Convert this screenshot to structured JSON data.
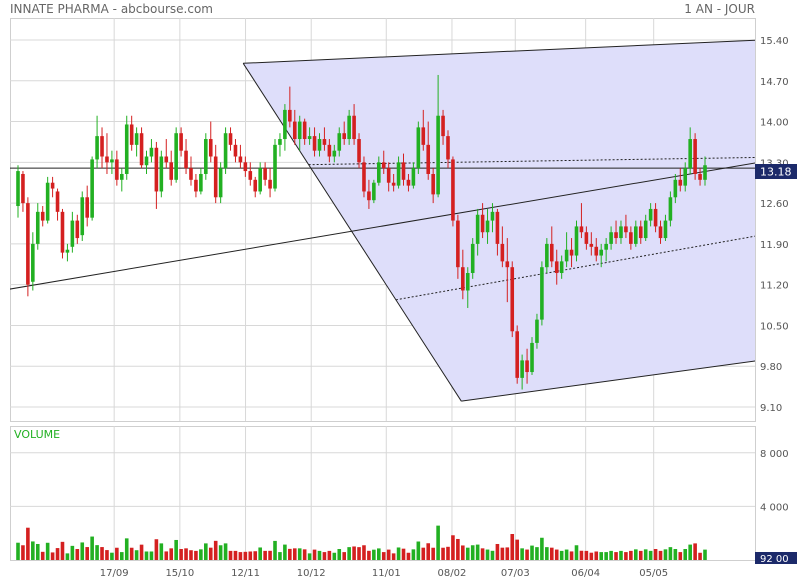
{
  "header": {
    "title": "INNATE PHARMA - abcbourse.com",
    "period": "1 AN - JOUR"
  },
  "colors": {
    "up": "#22b022",
    "down": "#d42020",
    "grid": "#d8d8d8",
    "fan_fill": "#dedefa",
    "axis_text": "#555555",
    "volume_label": "#22b022",
    "price_tag_bg": "#1c2a6a"
  },
  "chart_data": [
    {
      "type": "candlestick",
      "title": "",
      "price_ticks": [
        "15.40",
        "14.70",
        "14.00",
        "13.30",
        "12.60",
        "11.90",
        "11.20",
        "10.50",
        "9.80",
        "9.10"
      ],
      "ylim": [
        9.1,
        15.4
      ],
      "x_ticks": [
        {
          "label": "17/09",
          "day": 48
        },
        {
          "label": "15/10",
          "day": 76
        },
        {
          "label": "12/11",
          "day": 104
        },
        {
          "label": "10/12",
          "day": 132
        },
        {
          "label": "11/01",
          "day": 164
        },
        {
          "label": "08/02",
          "day": 192
        },
        {
          "label": "07/03",
          "day": 219
        },
        {
          "label": "06/04",
          "day": 249
        },
        {
          "label": "05/05",
          "day": 278
        }
      ],
      "grid": true,
      "current_price": {
        "value": 13.18,
        "label": "13.18"
      },
      "horizontal_line": 13.2,
      "candles_ohlc": [
        [
          12.55,
          13.25,
          12.35,
          13.15
        ],
        [
          13.1,
          13.15,
          12.45,
          12.6
        ],
        [
          12.6,
          12.7,
          11.0,
          11.2
        ],
        [
          11.25,
          12.1,
          11.1,
          11.9
        ],
        [
          11.9,
          12.6,
          11.8,
          12.45
        ],
        [
          12.45,
          12.55,
          12.2,
          12.3
        ],
        [
          12.3,
          13.05,
          12.25,
          12.95
        ],
        [
          12.95,
          13.05,
          12.7,
          12.85
        ],
        [
          12.8,
          12.85,
          12.3,
          12.45
        ],
        [
          12.45,
          12.5,
          11.65,
          11.75
        ],
        [
          11.75,
          11.9,
          11.6,
          11.8
        ],
        [
          11.85,
          12.45,
          11.75,
          12.3
        ],
        [
          12.3,
          12.4,
          11.9,
          12.0
        ],
        [
          12.05,
          12.8,
          11.95,
          12.7
        ],
        [
          12.7,
          12.9,
          12.2,
          12.35
        ],
        [
          12.35,
          13.4,
          12.3,
          13.35
        ],
        [
          13.35,
          14.1,
          13.2,
          13.75
        ],
        [
          13.75,
          13.9,
          13.2,
          13.4
        ],
        [
          13.4,
          13.8,
          13.1,
          13.3
        ],
        [
          13.3,
          13.5,
          13.1,
          13.35
        ],
        [
          13.35,
          13.5,
          12.9,
          13.0
        ],
        [
          13.0,
          13.2,
          12.8,
          13.1
        ],
        [
          13.1,
          14.1,
          13.0,
          13.95
        ],
        [
          13.95,
          14.1,
          13.5,
          13.6
        ],
        [
          13.6,
          13.9,
          13.4,
          13.8
        ],
        [
          13.8,
          13.9,
          13.2,
          13.25
        ],
        [
          13.25,
          13.5,
          13.1,
          13.4
        ],
        [
          13.4,
          13.7,
          13.3,
          13.55
        ],
        [
          13.55,
          13.65,
          12.5,
          12.8
        ],
        [
          12.8,
          13.5,
          12.7,
          13.4
        ],
        [
          13.4,
          13.7,
          13.2,
          13.3
        ],
        [
          13.3,
          13.5,
          12.9,
          13.0
        ],
        [
          13.0,
          13.9,
          12.95,
          13.8
        ],
        [
          13.8,
          13.9,
          13.4,
          13.5
        ],
        [
          13.5,
          13.7,
          13.1,
          13.2
        ],
        [
          13.2,
          13.4,
          12.9,
          13.0
        ],
        [
          13.0,
          13.1,
          12.7,
          12.8
        ],
        [
          12.8,
          13.2,
          12.75,
          13.1
        ],
        [
          13.1,
          13.8,
          13.0,
          13.7
        ],
        [
          13.7,
          14.0,
          13.3,
          13.4
        ],
        [
          13.4,
          13.6,
          12.6,
          12.7
        ],
        [
          12.7,
          13.3,
          12.6,
          13.2
        ],
        [
          13.2,
          13.9,
          13.1,
          13.8
        ],
        [
          13.8,
          13.9,
          13.5,
          13.6
        ],
        [
          13.6,
          13.7,
          13.3,
          13.4
        ],
        [
          13.4,
          13.6,
          13.2,
          13.3
        ],
        [
          13.3,
          13.4,
          13.05,
          13.15
        ],
        [
          13.15,
          13.3,
          12.9,
          13.0
        ],
        [
          13.0,
          13.05,
          12.7,
          12.8
        ],
        [
          12.8,
          13.3,
          12.75,
          13.2
        ],
        [
          13.2,
          13.3,
          12.9,
          13.0
        ],
        [
          13.0,
          13.2,
          12.7,
          12.85
        ],
        [
          12.85,
          13.7,
          12.8,
          13.6
        ],
        [
          13.6,
          13.8,
          13.4,
          13.7
        ],
        [
          13.7,
          14.3,
          13.5,
          14.2
        ],
        [
          14.2,
          14.6,
          13.9,
          14.0
        ],
        [
          14.0,
          14.2,
          13.6,
          13.7
        ],
        [
          13.7,
          14.1,
          13.5,
          14.0
        ],
        [
          14.0,
          14.05,
          13.6,
          13.7
        ],
        [
          13.7,
          13.9,
          13.6,
          13.75
        ],
        [
          13.75,
          13.9,
          13.4,
          13.5
        ],
        [
          13.5,
          13.8,
          13.4,
          13.7
        ],
        [
          13.7,
          13.9,
          13.5,
          13.6
        ],
        [
          13.6,
          13.7,
          13.3,
          13.4
        ],
        [
          13.4,
          13.6,
          13.3,
          13.5
        ],
        [
          13.5,
          13.9,
          13.4,
          13.8
        ],
        [
          13.8,
          14.0,
          13.6,
          13.7
        ],
        [
          13.7,
          14.2,
          13.6,
          14.1
        ],
        [
          14.1,
          14.3,
          13.6,
          13.7
        ],
        [
          13.7,
          13.8,
          13.2,
          13.3
        ],
        [
          13.3,
          13.4,
          12.7,
          12.8
        ],
        [
          12.8,
          13.0,
          12.5,
          12.65
        ],
        [
          12.65,
          13.0,
          12.6,
          12.95
        ],
        [
          12.95,
          13.4,
          12.9,
          13.3
        ],
        [
          13.3,
          13.5,
          13.1,
          13.2
        ],
        [
          13.2,
          13.3,
          12.8,
          12.95
        ],
        [
          12.95,
          13.1,
          12.8,
          12.9
        ],
        [
          12.9,
          13.4,
          12.85,
          13.3
        ],
        [
          13.3,
          13.45,
          12.9,
          13.0
        ],
        [
          13.0,
          13.1,
          12.8,
          12.9
        ],
        [
          12.9,
          13.3,
          12.85,
          13.2
        ],
        [
          13.2,
          14.0,
          13.1,
          13.9
        ],
        [
          13.9,
          14.2,
          13.5,
          13.6
        ],
        [
          13.6,
          14.0,
          13.0,
          13.1
        ],
        [
          13.1,
          13.2,
          12.6,
          12.75
        ],
        [
          12.75,
          14.8,
          12.7,
          14.1
        ],
        [
          14.1,
          14.2,
          13.6,
          13.75
        ],
        [
          13.75,
          13.85,
          13.2,
          13.35
        ],
        [
          13.35,
          13.4,
          12.2,
          12.3
        ],
        [
          12.3,
          12.4,
          11.3,
          11.5
        ],
        [
          11.5,
          11.8,
          10.95,
          11.1
        ],
        [
          11.1,
          11.5,
          10.8,
          11.4
        ],
        [
          11.4,
          12.0,
          11.3,
          11.9
        ],
        [
          11.9,
          12.5,
          11.7,
          12.4
        ],
        [
          12.4,
          12.6,
          12.0,
          12.1
        ],
        [
          12.1,
          12.5,
          11.9,
          12.3
        ],
        [
          12.3,
          12.6,
          12.1,
          12.45
        ],
        [
          12.45,
          12.5,
          11.7,
          11.9
        ],
        [
          11.9,
          12.2,
          11.5,
          11.6
        ],
        [
          11.6,
          12.0,
          10.9,
          11.5
        ],
        [
          11.5,
          11.6,
          10.3,
          10.4
        ],
        [
          10.4,
          10.5,
          9.5,
          9.6
        ],
        [
          9.6,
          10.0,
          9.4,
          9.9
        ],
        [
          9.9,
          10.1,
          9.5,
          9.7
        ],
        [
          9.7,
          10.3,
          9.65,
          10.2
        ],
        [
          10.2,
          10.7,
          10.1,
          10.6
        ],
        [
          10.6,
          11.6,
          10.5,
          11.5
        ],
        [
          11.5,
          12.0,
          11.4,
          11.9
        ],
        [
          11.9,
          12.2,
          11.5,
          11.6
        ],
        [
          11.6,
          11.8,
          11.2,
          11.4
        ],
        [
          11.4,
          11.7,
          11.3,
          11.6
        ],
        [
          11.6,
          12.1,
          11.5,
          11.8
        ],
        [
          11.8,
          12.0,
          11.5,
          11.7
        ],
        [
          11.7,
          12.3,
          11.6,
          12.2
        ],
        [
          12.2,
          12.6,
          12.0,
          12.1
        ],
        [
          12.1,
          12.2,
          11.8,
          11.9
        ],
        [
          11.9,
          12.1,
          11.7,
          11.85
        ],
        [
          11.85,
          12.0,
          11.6,
          11.7
        ],
        [
          11.7,
          11.9,
          11.5,
          11.8
        ],
        [
          11.8,
          12.0,
          11.6,
          11.9
        ],
        [
          11.9,
          12.2,
          11.8,
          12.1
        ],
        [
          12.1,
          12.3,
          11.9,
          12.0
        ],
        [
          12.0,
          12.3,
          11.9,
          12.2
        ],
        [
          12.2,
          12.4,
          12.0,
          12.1
        ],
        [
          12.1,
          12.2,
          11.8,
          11.9
        ],
        [
          11.9,
          12.3,
          11.85,
          12.2
        ],
        [
          12.2,
          12.3,
          11.9,
          12.0
        ],
        [
          12.0,
          12.4,
          11.95,
          12.3
        ],
        [
          12.3,
          12.6,
          12.2,
          12.5
        ],
        [
          12.5,
          12.6,
          12.1,
          12.2
        ],
        [
          12.2,
          12.3,
          11.9,
          12.0
        ],
        [
          12.0,
          12.4,
          11.95,
          12.3
        ],
        [
          12.3,
          12.8,
          12.2,
          12.7
        ],
        [
          12.7,
          13.1,
          12.6,
          13.0
        ],
        [
          13.0,
          13.2,
          12.8,
          12.9
        ],
        [
          12.9,
          13.3,
          12.8,
          13.2
        ],
        [
          13.2,
          13.9,
          13.1,
          13.7
        ],
        [
          13.7,
          13.8,
          13.0,
          13.1
        ],
        [
          13.1,
          13.2,
          12.9,
          13.0
        ],
        [
          13.0,
          13.4,
          12.9,
          13.25
        ]
      ],
      "overlays": [
        {
          "kind": "andrews_pitchfork_fan",
          "pivots": [
            {
              "day": 103,
              "price": 15.0
            },
            {
              "day": 196,
              "price": 9.2
            }
          ],
          "median_line": [
            {
              "day": 0,
              "price": 11.1
            },
            {
              "day": 323,
              "price": 13.3
            }
          ],
          "upper_line": [
            {
              "day": 103,
              "price": 15.0
            },
            {
              "day": 323,
              "price": 15.4
            }
          ],
          "lower_line": [
            {
              "day": 196,
              "price": 9.2
            },
            {
              "day": 323,
              "price": 9.9
            }
          ]
        }
      ]
    },
    {
      "type": "bar",
      "title": "VOLUME",
      "y_ticks": [
        "8 000",
        "4 000"
      ],
      "ylim": [
        0,
        10000
      ],
      "current_volume_label": "92 00"
    }
  ]
}
